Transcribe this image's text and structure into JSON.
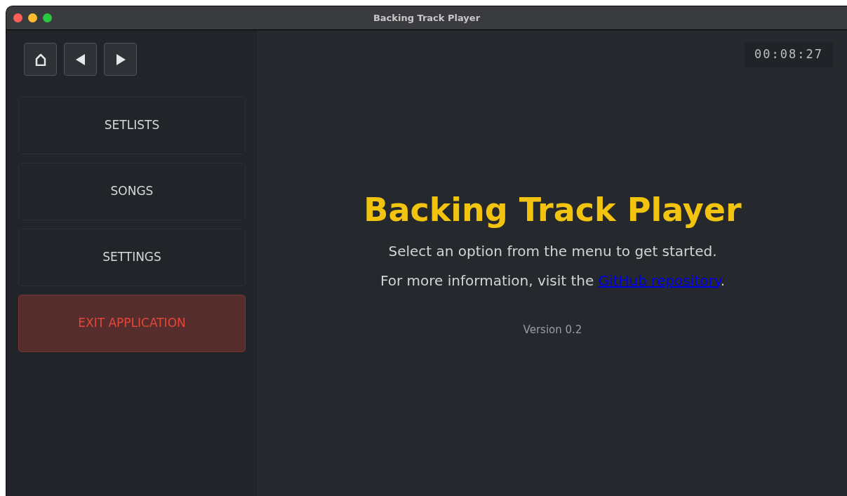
{
  "window": {
    "title": "Backing Track Player"
  },
  "nav_buttons": [
    {
      "kind": "home"
    },
    {
      "kind": "back"
    },
    {
      "kind": "forward"
    }
  ],
  "menu": [
    {
      "label": "SETLISTS",
      "kind": "normal"
    },
    {
      "label": "SONGS",
      "kind": "normal"
    },
    {
      "label": "SETTINGS",
      "kind": "normal"
    },
    {
      "label": "EXIT APPLICATION",
      "kind": "danger"
    }
  ],
  "timer": "00:08:27",
  "main": {
    "heading": "Backing Track Player",
    "line_1": "Select an option from the menu to get started.",
    "line_2": {
      "before": "For more information, visit the ",
      "link": "GitHub repository",
      "after": "."
    },
    "version": "Version 0.2"
  }
}
